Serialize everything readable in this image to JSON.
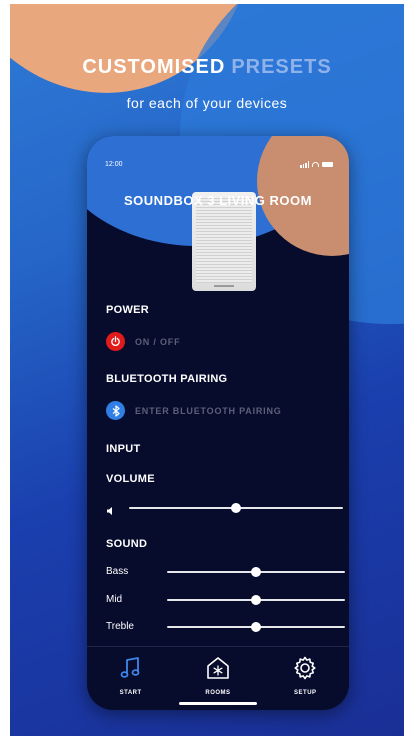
{
  "promo": {
    "headline_main": "CUSTOMISED",
    "headline_accent": "PRESETS",
    "subline": "for each of your devices"
  },
  "status_bar": {
    "time": "12:00"
  },
  "device": {
    "title": "SOUNDBOX 3  LIVING ROOM"
  },
  "sections": {
    "power": "POWER",
    "bluetooth": "BLUETOOTH PAIRING",
    "input": "INPUT",
    "volume": "VOLUME",
    "sound": "SOUND"
  },
  "power_toggle": {
    "label": "ON / OFF"
  },
  "bluetooth_pairing": {
    "label": "ENTER BLUETOOTH PAIRING"
  },
  "volume": {
    "level": 0.5
  },
  "eq": {
    "bass": {
      "label": "Bass",
      "level": 0.5
    },
    "mid": {
      "label": "Mid",
      "level": 0.5
    },
    "treble": {
      "label": "Treble",
      "level": 0.5
    }
  },
  "tabs": [
    {
      "label": "START",
      "icon": "music-note-icon"
    },
    {
      "label": "ROOMS",
      "icon": "rooms-icon"
    },
    {
      "label": "SETUP",
      "icon": "gear-icon"
    }
  ],
  "colors": {
    "power": "#e11a1a",
    "bluetooth": "#2f7fe6",
    "phone_bg": "#070b2c",
    "accent_text": "#8fb2ea"
  }
}
